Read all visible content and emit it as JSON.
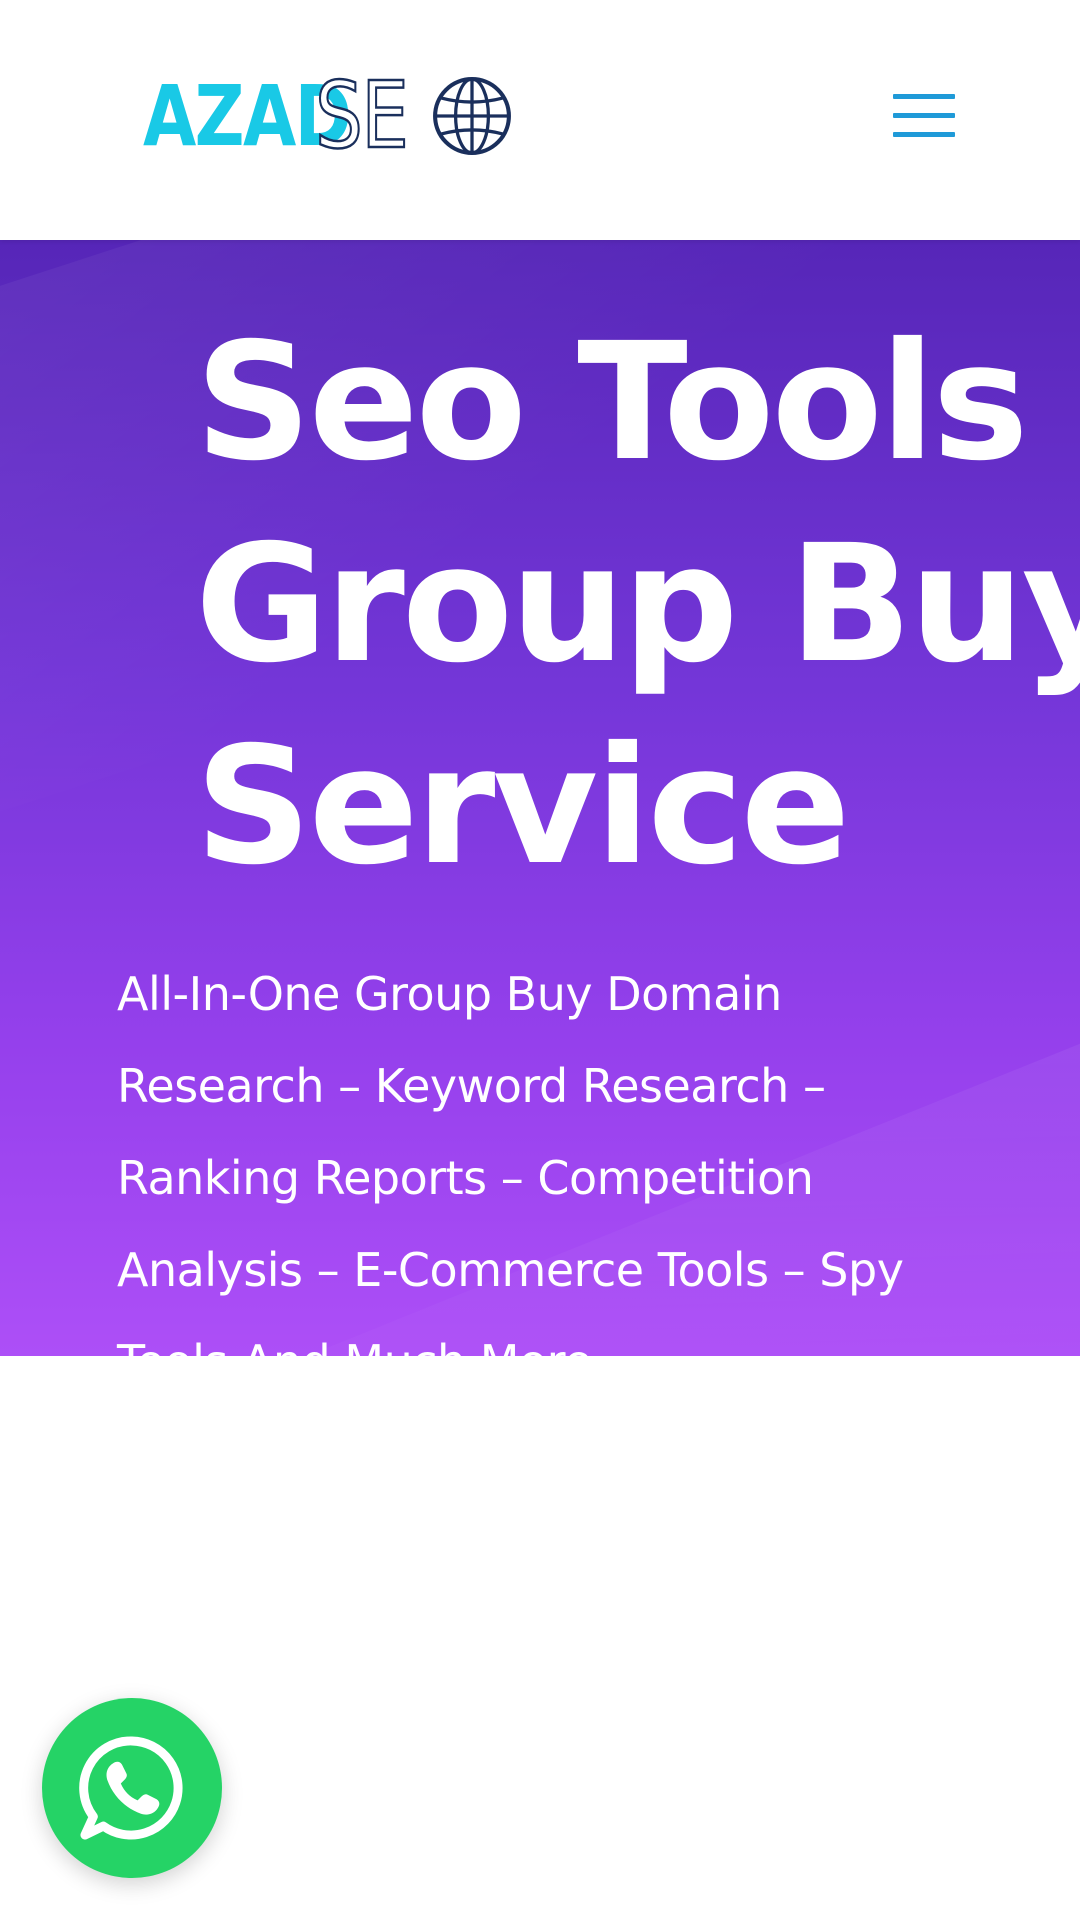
{
  "header": {
    "logo": {
      "part1": "AZAD",
      "part2": "SE",
      "globe_icon": "globe-icon"
    },
    "menu_icon": "hamburger-menu-icon"
  },
  "hero": {
    "title_lines": [
      "Seo Tools",
      "Group Buy",
      "Service"
    ],
    "subtitle_lines": [
      "All-In-One Group Buy Domain",
      "Research – Keyword Research –",
      "Ranking Reports – Competition",
      "Analysis – E-Commerce Tools – Spy",
      "Tools And Much More"
    ]
  },
  "floating": {
    "whatsapp_icon": "whatsapp-icon"
  },
  "colors": {
    "logo_cyan": "#19c9e6",
    "logo_navy": "#1a2f5c",
    "menu_blue": "#1f9ad8",
    "hero_gradient_top": "#5626b8",
    "hero_gradient_bottom": "#ad4ff7",
    "whatsapp_green": "#25d366"
  }
}
